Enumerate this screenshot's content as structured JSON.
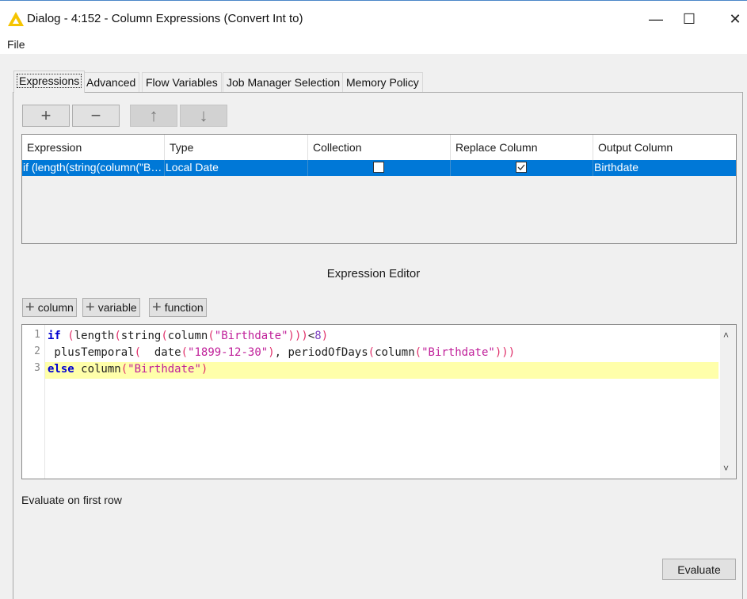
{
  "window": {
    "title": "Dialog - 4:152 - Column Expressions (Convert Int to)",
    "icon": "knime-warning-triangle-icon",
    "controls": [
      "minimize",
      "maximize",
      "close"
    ],
    "minimize_glyph": "—",
    "maximize_glyph": "☐",
    "close_glyph": "✕"
  },
  "menu": {
    "file": "File"
  },
  "tabs": [
    {
      "label": "Expressions",
      "active": true
    },
    {
      "label": "Advanced",
      "active": false
    },
    {
      "label": "Flow Variables",
      "active": false
    },
    {
      "label": "Job Manager Selection",
      "active": false
    },
    {
      "label": "Memory Policy",
      "active": false
    }
  ],
  "toolbar": {
    "add": "+",
    "remove": "−",
    "move_up": "↑",
    "move_down": "↓"
  },
  "table": {
    "columns": [
      "Expression",
      "Type",
      "Collection",
      "Replace Column",
      "Output Column"
    ],
    "rows": [
      {
        "expression": "if (length(string(column(\"B…",
        "type": "Local Date",
        "collection": false,
        "replace_column": true,
        "output_column": "Birthdate",
        "selected": true
      }
    ]
  },
  "editor": {
    "title": "Expression Editor",
    "insert_buttons": [
      "column",
      "variable",
      "function"
    ],
    "plus_glyph": "+",
    "line_numbers": [
      "1",
      "2",
      "3"
    ],
    "lines": [
      "if (length(string(column(\"Birthdate\")))<8)",
      " plusTemporal(  date(\"1899-12-30\"), periodOfDays(column(\"Birthdate\")))",
      "else column(\"Birthdate\")"
    ],
    "highlighted_line": 3,
    "scroll_up": "˄",
    "scroll_down": "˅"
  },
  "evaluate": {
    "label": "Evaluate on first row",
    "button": "Evaluate"
  },
  "colors": {
    "selection": "#0078d7",
    "line_highlight": "#ffffaa",
    "keyword": "#0000d0",
    "string": "#c0209a"
  }
}
